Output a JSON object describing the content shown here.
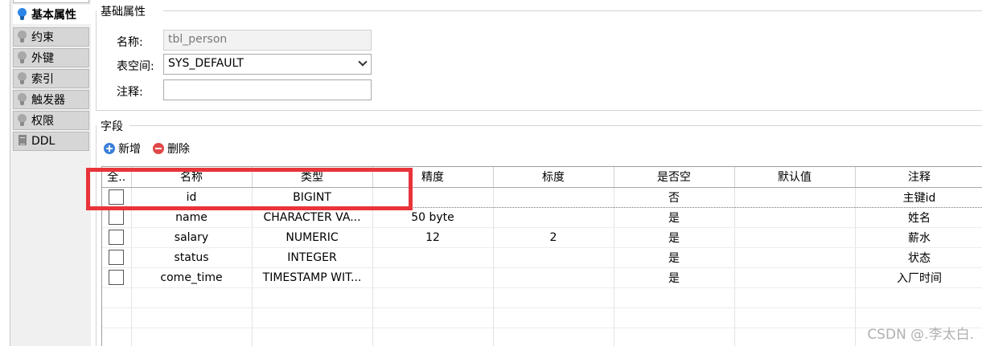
{
  "nav": {
    "items": [
      {
        "label": "基本属性",
        "icon": "lightbulb-blue-icon",
        "active": true
      },
      {
        "label": "约束",
        "icon": "lightbulb-icon"
      },
      {
        "label": "外键",
        "icon": "lightbulb-icon"
      },
      {
        "label": "索引",
        "icon": "lightbulb-icon"
      },
      {
        "label": "触发器",
        "icon": "lightbulb-icon"
      },
      {
        "label": "权限",
        "icon": "lightbulb-icon"
      },
      {
        "label": "DDL",
        "icon": "document-icon"
      }
    ]
  },
  "basic": {
    "section_title": "基础属性",
    "name_label": "名称:",
    "name_value": "tbl_person",
    "tablespace_label": "表空间:",
    "tablespace_value": "SYS_DEFAULT",
    "comment_label": "注释:",
    "comment_value": ""
  },
  "fields": {
    "section_title": "字段",
    "add_label": "新增",
    "delete_label": "删除",
    "columns": [
      "全..",
      "名称",
      "类型",
      "精度",
      "标度",
      "是否空",
      "默认值",
      "注释"
    ],
    "rows": [
      {
        "name": "id",
        "type": "BIGINT",
        "precision": "",
        "scale": "",
        "nullable": "否",
        "default": "",
        "comment": "主键id"
      },
      {
        "name": "name",
        "type": "CHARACTER VA...",
        "precision": "50 byte",
        "scale": "",
        "nullable": "是",
        "default": "",
        "comment": "姓名"
      },
      {
        "name": "salary",
        "type": "NUMERIC",
        "precision": "12",
        "scale": "2",
        "nullable": "是",
        "default": "",
        "comment": "薪水"
      },
      {
        "name": "status",
        "type": "INTEGER",
        "precision": "",
        "scale": "",
        "nullable": "是",
        "default": "",
        "comment": "状态"
      },
      {
        "name": "come_time",
        "type": "TIMESTAMP WIT...",
        "precision": "",
        "scale": "",
        "nullable": "是",
        "default": "",
        "comment": "入厂时间"
      }
    ]
  },
  "watermark": "CSDN @.李太白.",
  "colors": {
    "highlight": "#e8343a",
    "accent_blue": "#2d86e6"
  }
}
